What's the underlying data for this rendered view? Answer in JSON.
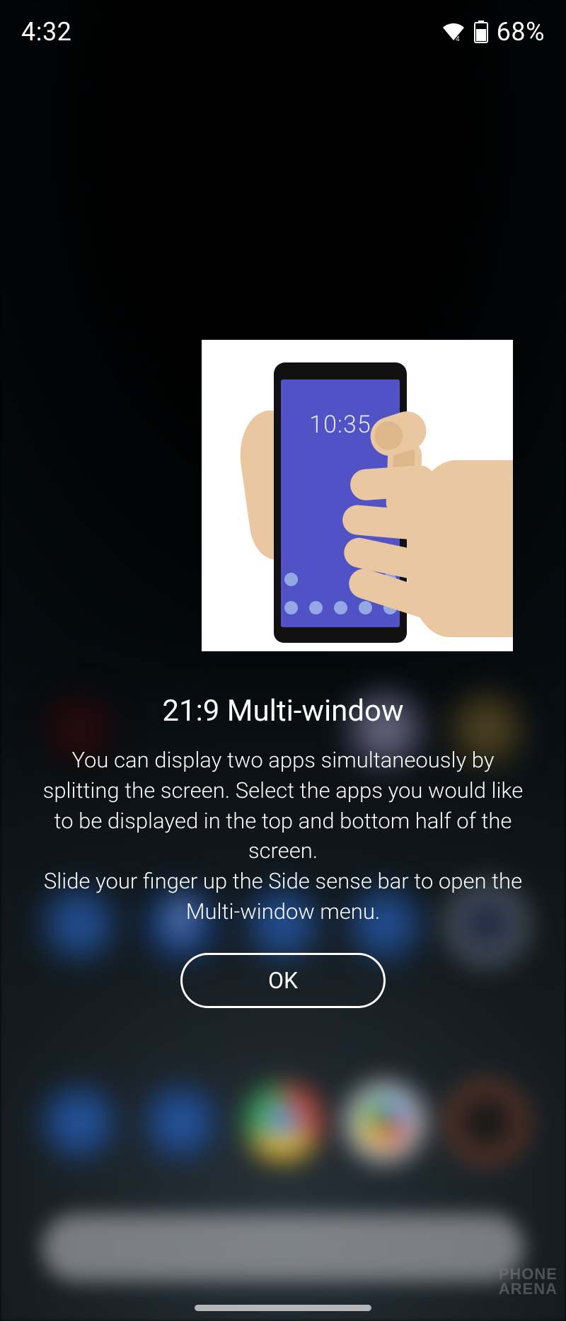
{
  "status": {
    "time": "4:32",
    "battery_text": "68%",
    "battery_level": 68
  },
  "tutorial": {
    "illustration_clock": "10:35",
    "title": "21:9 Multi-window",
    "body_line1": "You can display two apps simultaneously by splitting the screen. Select the apps you would like to be displayed in the top and bottom half of the screen.",
    "body_line2": "Slide your finger up the Side sense bar to open the Multi-window menu.",
    "ok_label": "OK"
  },
  "watermark": {
    "line1": "PHONE",
    "line2": "ARENA"
  }
}
